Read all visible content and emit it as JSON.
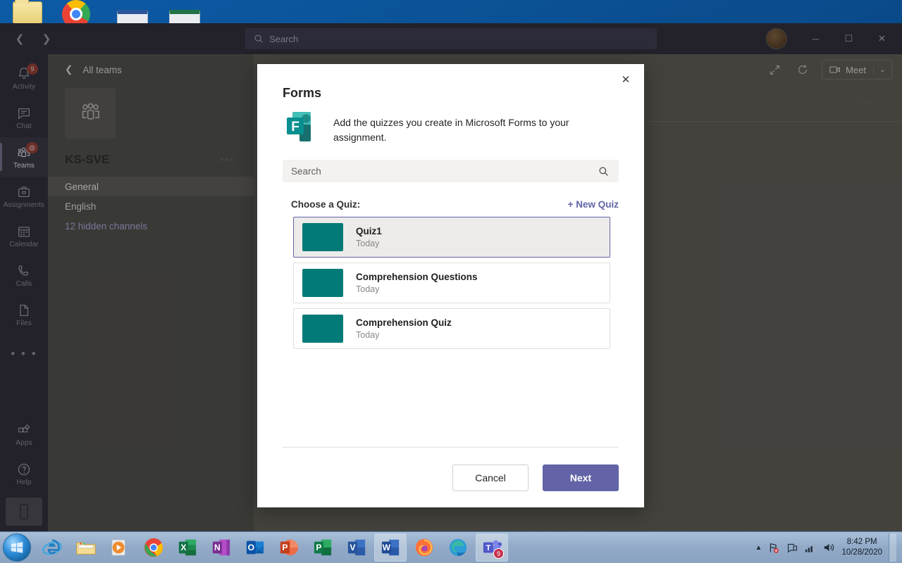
{
  "desktop": {
    "icons": [
      "folder-icon",
      "chrome-icon",
      "document-icon",
      "excel-document-icon"
    ]
  },
  "titlebar": {
    "back_icon": "chevron-left-icon",
    "forward_icon": "chevron-right-icon",
    "search_placeholder": "Search",
    "search_icon": "search-icon",
    "minimize_label": "─",
    "maximize_label": "☐",
    "close_label": "✕"
  },
  "rail": {
    "items": [
      {
        "label": "Activity",
        "icon": "bell-icon",
        "badge": "9"
      },
      {
        "label": "Chat",
        "icon": "chat-icon",
        "badge": ""
      },
      {
        "label": "Teams",
        "icon": "teams-icon",
        "badge": "@"
      },
      {
        "label": "Assignments",
        "icon": "assignments-icon",
        "badge": ""
      },
      {
        "label": "Calendar",
        "icon": "calendar-icon",
        "badge": ""
      },
      {
        "label": "Calls",
        "icon": "phone-icon",
        "badge": ""
      },
      {
        "label": "Files",
        "icon": "files-icon",
        "badge": ""
      }
    ],
    "more_label": "• • •",
    "apps": {
      "label": "Apps",
      "icon": "apps-icon"
    },
    "help": {
      "label": "Help",
      "icon": "help-circle-icon"
    },
    "download_icon": "mobile-download-icon"
  },
  "leftpane": {
    "back_label": "All teams",
    "back_icon": "chevron-left-icon",
    "team_avatar_icon": "team-people-icon",
    "team_name": "KS-SVE",
    "team_more_label": "•••",
    "channels": [
      {
        "label": "General",
        "selected": true
      },
      {
        "label": "English",
        "selected": false
      }
    ],
    "hidden_channels_label": "12 hidden channels"
  },
  "content": {
    "expand_icon": "expand-icon",
    "refresh_icon": "refresh-icon",
    "meet_label": "Meet",
    "meet_icon": "video-camera-icon",
    "meet_caret": "⌄",
    "more_label": "•••"
  },
  "modal": {
    "title": "Forms",
    "close_icon": "close-icon",
    "app_icon": "microsoft-forms-icon",
    "description": "Add the quizzes you create in Microsoft Forms to your assignment.",
    "search_placeholder": "Search",
    "search_icon": "search-icon",
    "choose_label": "Choose a Quiz:",
    "new_quiz_label": "+ New Quiz",
    "quizzes": [
      {
        "title": "Quiz1",
        "date": "Today",
        "selected": true
      },
      {
        "title": "Comprehension Questions",
        "date": "Today",
        "selected": false
      },
      {
        "title": "Comprehension Quiz",
        "date": "Today",
        "selected": false
      }
    ],
    "cancel_label": "Cancel",
    "next_label": "Next",
    "accent_color": "#6264a7",
    "thumb_color": "#027b78"
  },
  "taskbar": {
    "start_icon": "windows-start-icon",
    "items": [
      {
        "name": "internet-explorer",
        "running": false,
        "badge": ""
      },
      {
        "name": "file-explorer",
        "running": false,
        "badge": ""
      },
      {
        "name": "windows-media-player",
        "running": false,
        "badge": ""
      },
      {
        "name": "google-chrome",
        "running": false,
        "badge": ""
      },
      {
        "name": "excel",
        "running": false,
        "badge": ""
      },
      {
        "name": "onenote",
        "running": false,
        "badge": ""
      },
      {
        "name": "outlook",
        "running": false,
        "badge": ""
      },
      {
        "name": "powerpoint",
        "running": false,
        "badge": ""
      },
      {
        "name": "publisher",
        "running": false,
        "badge": ""
      },
      {
        "name": "visio",
        "running": false,
        "badge": ""
      },
      {
        "name": "word",
        "running": true,
        "badge": ""
      },
      {
        "name": "firefox",
        "running": false,
        "badge": ""
      },
      {
        "name": "microsoft-edge",
        "running": false,
        "badge": ""
      },
      {
        "name": "microsoft-teams",
        "running": true,
        "badge": "9"
      }
    ],
    "tray": {
      "show_hidden_icon": "chevron-up-icon",
      "network_icon": "network-error-icon",
      "action_center_icon": "action-center-icon",
      "signal_icon": "signal-bars-icon",
      "volume_icon": "speaker-icon",
      "time": "8:42 PM",
      "date": "10/28/2020"
    }
  }
}
